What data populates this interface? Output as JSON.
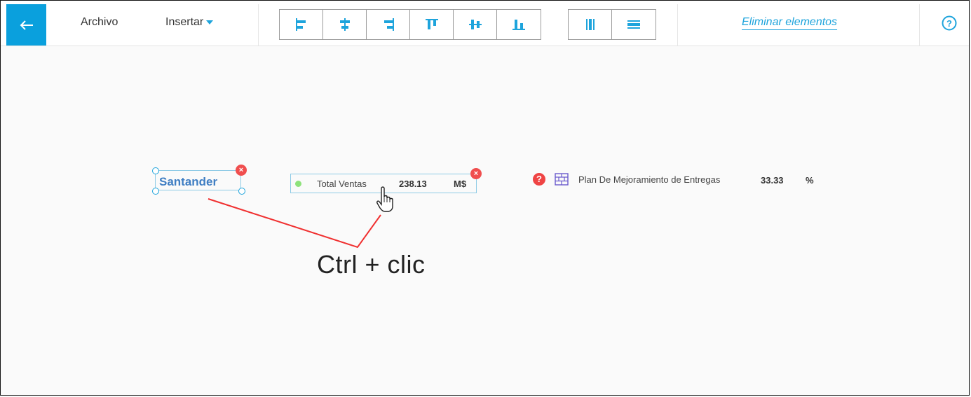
{
  "toolbar": {
    "menu_archivo": "Archivo",
    "menu_insertar": "Insertar",
    "align_buttons": [
      "align-left",
      "align-center-horizontal",
      "align-right",
      "align-top",
      "align-center-vertical",
      "align-bottom"
    ],
    "distribute_buttons": [
      "distribute-horizontal",
      "distribute-vertical"
    ],
    "eliminar_label": "Eliminar elementos",
    "help_symbol": "?",
    "accent": "#1ea4dc",
    "back_color": "#0aa0dd"
  },
  "canvas": {
    "santander": {
      "label": "Santander",
      "color": "#3f7ec3"
    },
    "total_ventas": {
      "label": "Total Ventas",
      "value": "238.13",
      "unit": "M$",
      "status_color": "#8ee27b"
    },
    "plan": {
      "help": "?",
      "label": "Plan De Mejoramiento de Entregas",
      "value": "33.33",
      "unit": "%"
    },
    "annotation": "Ctrl + clic",
    "annotation_line_color": "#f03030",
    "close_symbol": "×"
  }
}
